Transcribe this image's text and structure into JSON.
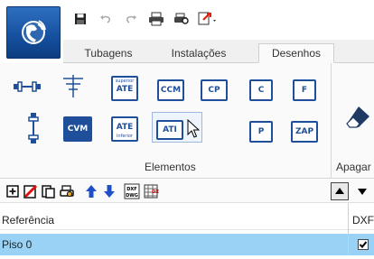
{
  "app_button": {
    "icon": "app-logo-icon"
  },
  "quick_access": [
    {
      "name": "save-icon"
    },
    {
      "name": "undo-icon"
    },
    {
      "name": "redo-icon"
    },
    {
      "name": "print-icon"
    },
    {
      "name": "preview-icon"
    },
    {
      "name": "customize-qat-icon"
    }
  ],
  "tabs": [
    {
      "label": "Tubagens"
    },
    {
      "label": "Instalações"
    },
    {
      "label": "Desenhos",
      "active": true
    }
  ],
  "ribbon": {
    "group_label": "Elementos",
    "group2_label": "Apagar",
    "buttons": {
      "ate_top": {
        "label": "ATE",
        "small": "superior"
      },
      "ccm": {
        "label": "CCM"
      },
      "cp": {
        "label": "CP"
      },
      "c": {
        "label": "C"
      },
      "f": {
        "label": "F"
      },
      "cvm": {
        "label": "CVM"
      },
      "ate_bot": {
        "label": "ATE",
        "small": "inferior"
      },
      "ati": {
        "label": "ATI"
      },
      "p": {
        "label": "P"
      },
      "zap": {
        "label": "ZAP"
      }
    }
  },
  "toolbar": {
    "items": [
      "add-icon",
      "delete-icon",
      "copy-icon",
      "print-icon",
      "move-up-icon",
      "move-down-icon",
      "dxf-import-icon",
      "dxf-table-icon"
    ]
  },
  "table": {
    "headers": {
      "ref": "Referência",
      "dxf": "DXF"
    },
    "rows": [
      {
        "ref": "Piso 0",
        "dxf": true
      }
    ]
  },
  "colors": {
    "accent": "#1f4f9a",
    "selection": "#99d2f4"
  }
}
